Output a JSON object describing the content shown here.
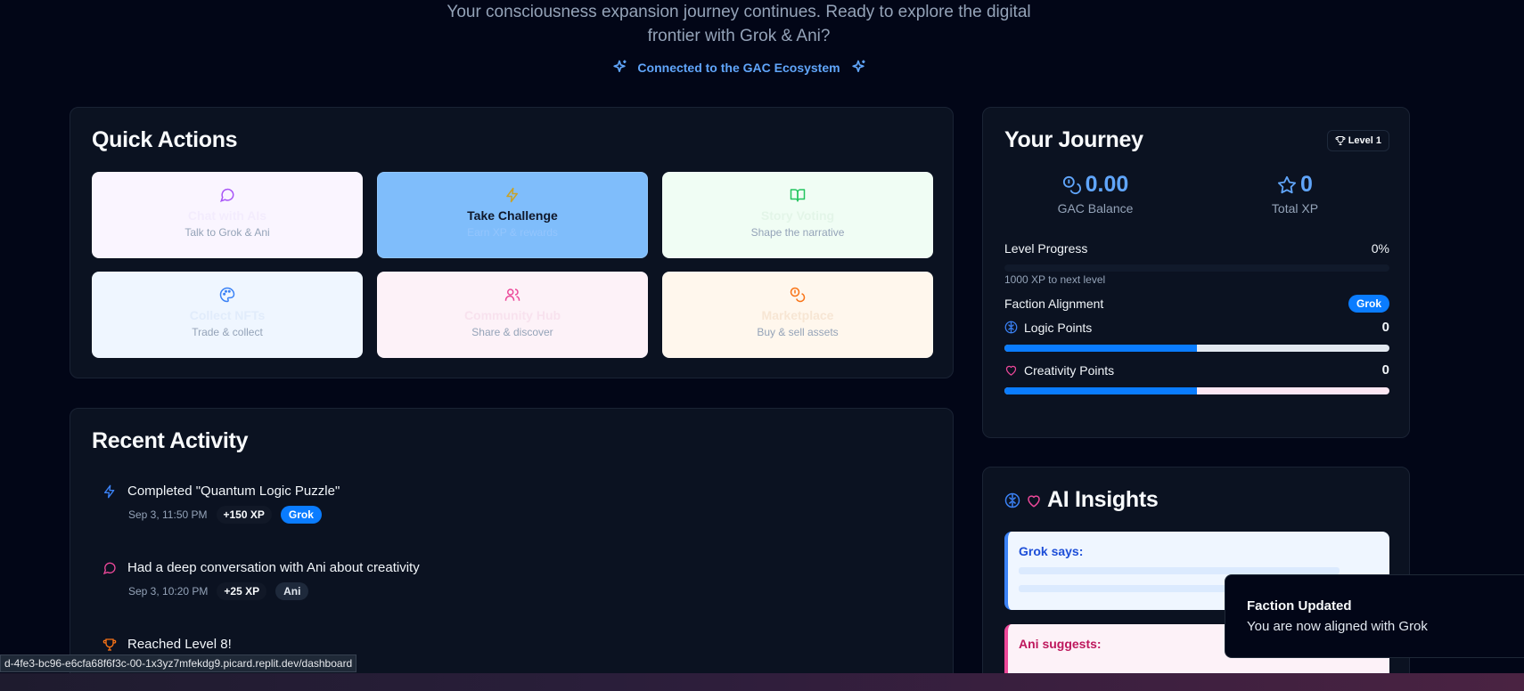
{
  "hero": {
    "subtitle_line1": "Your consciousness expansion journey continues. Ready to explore the digital",
    "subtitle_line2": "frontier with Grok & Ani?",
    "ecosystem": "Connected to the GAC Ecosystem"
  },
  "quick_actions": {
    "title": "Quick Actions",
    "items": [
      {
        "title": "Chat with AIs",
        "subtitle": "Talk to Grok & Ani",
        "icon": "message-circle-icon",
        "bg": "#faf5ff",
        "accent": "#a855f7"
      },
      {
        "title": "Take Challenge",
        "subtitle": "Earn XP & rewards",
        "icon": "zap-icon",
        "bg": "#7fbdfb",
        "accent": "#eab308"
      },
      {
        "title": "Story Voting",
        "subtitle": "Shape the narrative",
        "icon": "book-open-icon",
        "bg": "#f0fdf4",
        "accent": "#22c55e"
      },
      {
        "title": "Collect NFTs",
        "subtitle": "Trade & collect",
        "icon": "palette-icon",
        "bg": "#eff6ff",
        "accent": "#3b82f6"
      },
      {
        "title": "Community Hub",
        "subtitle": "Share & discover",
        "icon": "users-icon",
        "bg": "#fdf2f8",
        "accent": "#ec4899"
      },
      {
        "title": "Marketplace",
        "subtitle": "Buy & sell assets",
        "icon": "coins-icon",
        "bg": "#fff7ed",
        "accent": "#f97316"
      }
    ]
  },
  "journey": {
    "title": "Your Journey",
    "level_badge": "Level 1",
    "gac_balance": "0.00",
    "gac_label": "GAC Balance",
    "total_xp": "0",
    "xp_label": "Total XP",
    "level_progress_label": "Level Progress",
    "level_progress_value": "0%",
    "level_progress_fraction": 0,
    "next_level_note": "1000 XP to next level",
    "faction_label": "Faction Alignment",
    "faction": "Grok",
    "logic_label": "Logic Points",
    "logic_value": "0",
    "logic_fraction": 0.5,
    "creativity_label": "Creativity Points",
    "creativity_value": "0",
    "creativity_fraction": 0.5
  },
  "activity": {
    "title": "Recent Activity",
    "items": [
      {
        "text": "Completed \"Quantum Logic Puzzle\"",
        "time": "Sep 3, 11:50 PM",
        "xp": "+150 XP",
        "tag": "Grok",
        "icon": "zap-icon"
      },
      {
        "text": "Had a deep conversation with Ani about creativity",
        "time": "Sep 3, 10:20 PM",
        "xp": "+25 XP",
        "tag": "Ani",
        "icon": "message-circle-icon"
      },
      {
        "text": "Reached Level 8!",
        "icon": "trophy-icon"
      }
    ]
  },
  "insights": {
    "title": "AI Insights",
    "grok_label": "Grok says:",
    "ani_label": "Ani suggests:"
  },
  "toast": {
    "title": "Faction Updated",
    "message": "You are now aligned with Grok"
  },
  "status_url": "d-4fe3-bc96-e6cfa68f6f3c-00-1x3yz7mfekdg9.picard.replit.dev/dashboard"
}
